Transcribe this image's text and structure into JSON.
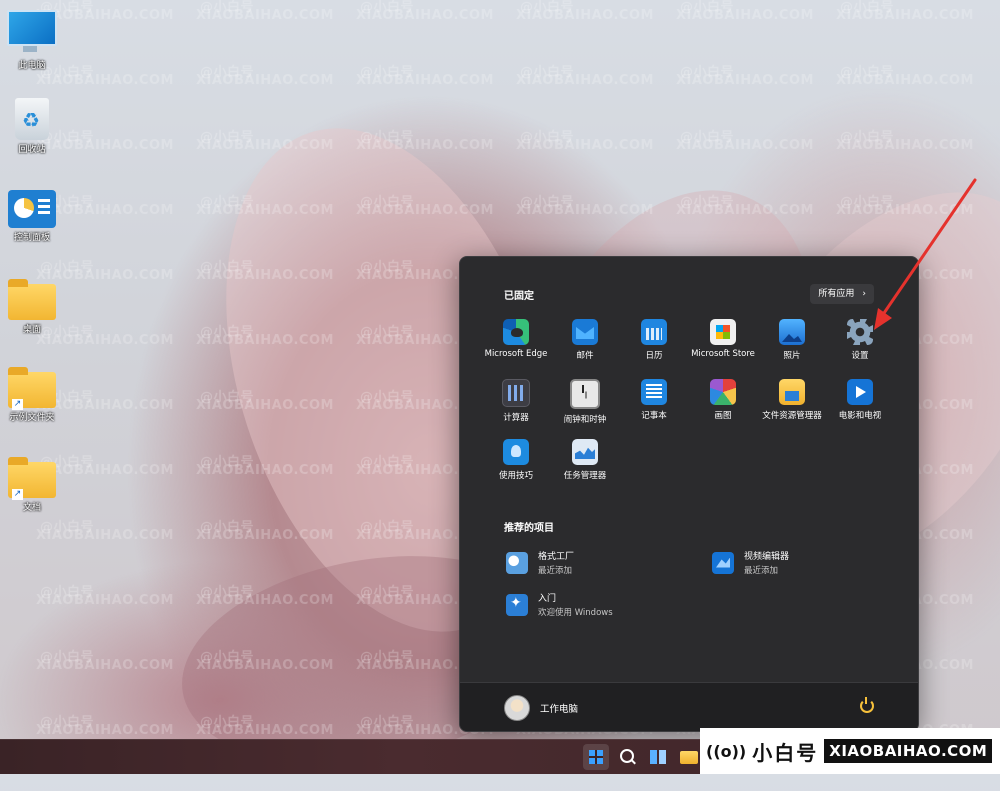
{
  "desktop": {
    "icons": [
      {
        "label": "此电脑",
        "icon": "this-pc-icon"
      },
      {
        "label": "回收站",
        "icon": "recycle-bin-icon"
      },
      {
        "label": "控制面板",
        "icon": "control-panel-icon"
      },
      {
        "label": "桌面",
        "icon": "folder-icon"
      },
      {
        "label": "示例文件夹",
        "icon": "folder-shortcut-icon"
      },
      {
        "label": "文档",
        "icon": "folder-shortcut-icon"
      }
    ],
    "watermark_handle": "@小白号",
    "watermark_site": "XIAOBAIHAO.COM"
  },
  "start_menu": {
    "pinned_title": "已固定",
    "all_apps_label": "所有应用",
    "all_apps_chevron": "›",
    "pinned_apps": [
      {
        "label": "Microsoft Edge",
        "icon": "edge-icon"
      },
      {
        "label": "邮件",
        "icon": "mail-icon"
      },
      {
        "label": "日历",
        "icon": "calendar-icon"
      },
      {
        "label": "Microsoft Store",
        "icon": "store-icon"
      },
      {
        "label": "照片",
        "icon": "photos-icon"
      },
      {
        "label": "设置",
        "icon": "settings-icon"
      },
      {
        "label": "计算器",
        "icon": "calculator-icon"
      },
      {
        "label": "闹钟和时钟",
        "icon": "clock-icon"
      },
      {
        "label": "记事本",
        "icon": "notepad-icon"
      },
      {
        "label": "画图",
        "icon": "paint-icon"
      },
      {
        "label": "文件资源管理器",
        "icon": "file-explorer-icon"
      },
      {
        "label": "电影和电视",
        "icon": "movies-tv-icon"
      },
      {
        "label": "使用技巧",
        "icon": "tips-icon"
      },
      {
        "label": "任务管理器",
        "icon": "task-manager-icon"
      }
    ],
    "recommended_title": "推荐的项目",
    "recommended": [
      {
        "title": "格式工厂",
        "subtitle": "最近添加",
        "icon": "format-factory-icon"
      },
      {
        "title": "视频编辑器",
        "subtitle": "最近添加",
        "icon": "video-editor-icon"
      },
      {
        "title": "入门",
        "subtitle": "欢迎使用 Windows",
        "icon": "get-started-icon"
      }
    ],
    "user_name": "工作电脑",
    "power_icon": "power-icon"
  },
  "taskbar": {
    "items": [
      "start-icon",
      "search-icon",
      "widgets-icon",
      "file-explorer-icon"
    ]
  },
  "brand": {
    "signal": "((o))",
    "name_cn": "小白号",
    "name_en": "XIAOBAIHAO.COM"
  },
  "colors": {
    "menu_bg": "#2b2b2d",
    "annotation_arrow": "#e5322d",
    "accent": "#3aa0ff"
  }
}
